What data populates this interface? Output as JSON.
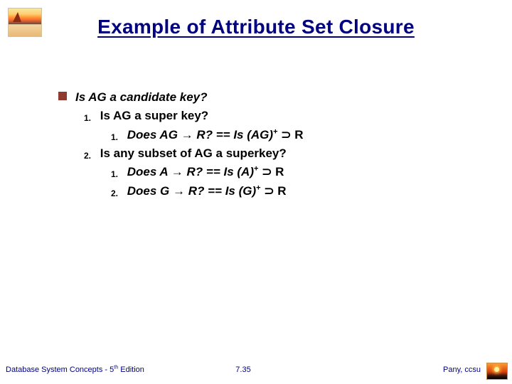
{
  "title": "Example of Attribute Set Closure",
  "q": {
    "main": "Is AG a candidate key?",
    "s1": {
      "num": "1.",
      "text": "Is AG a super key?",
      "c1": {
        "num": "1.",
        "lead": "Does AG ",
        "arrow": "→",
        "mid": " R? == Is (AG)",
        "sup": "+",
        "sub": " ⊃ R"
      }
    },
    "s2": {
      "num": "2.",
      "text": "Is any subset of AG a superkey?",
      "c1": {
        "num": "1.",
        "lead": "Does A ",
        "arrow": "→",
        "mid": " R? == Is (A)",
        "sup": "+",
        "sub": " ⊃ R"
      },
      "c2": {
        "num": "2.",
        "lead": "Does G ",
        "arrow": "→",
        "mid": " R? == Is (G)",
        "sup": "+",
        "sub": " ⊃ R"
      }
    }
  },
  "footer": {
    "left_a": "Database System Concepts - 5",
    "left_sup": "th",
    "left_b": " Edition",
    "center": "7.35",
    "right": "Pany, ccsu"
  }
}
